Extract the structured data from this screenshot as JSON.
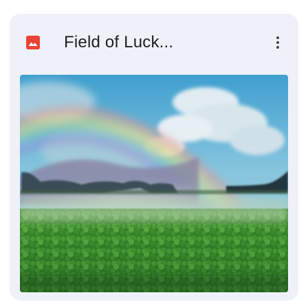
{
  "card": {
    "title": "Field of Luck...",
    "file_icon": "image-file-icon",
    "more_icon": "more-vert-icon",
    "thumbnail_icon": "image-thumbnail"
  },
  "colors": {
    "card_bg": "#eef1f7",
    "file_icon": "#ea4335",
    "title_text": "#1f1f1f",
    "menu_dots": "#444746"
  }
}
